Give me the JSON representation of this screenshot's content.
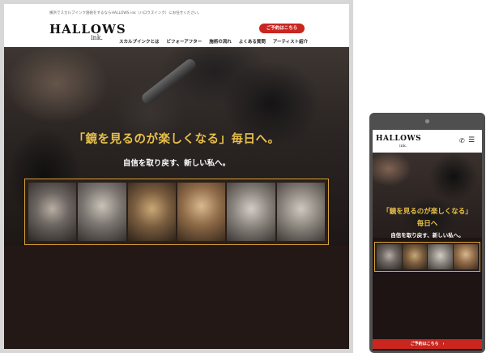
{
  "desktop": {
    "notice": "横浜でスカルプインク施術をするならHALLOWS ink（ハロウズインク）にお任せください。",
    "logo": "HALLOWS",
    "logo_sub": "ink.",
    "cta": "ご予約はこちら",
    "nav": [
      "スカルプインクとは",
      "ビフォーアフター",
      "施術の流れ",
      "よくある質問",
      "アーティスト紹介"
    ],
    "tagline": "「鏡を見るのが楽しくなる」毎日へ。",
    "subtitle": "自信を取り戻す、新しい私へ。"
  },
  "phone": {
    "logo": "HALLOWS",
    "logo_sub": "ink.",
    "tagline_line1": "「鏡を見るのが楽しくなる」",
    "tagline_line2": "毎日へ",
    "subtitle": "自信を取り戻す、新しい私へ。",
    "cta": "ご予約はこちら　›"
  },
  "colors": {
    "accent_red": "#c8261f",
    "tagline_gold": "#e7c04a",
    "strip_border": "#d6a13b",
    "dark_bg": "#241816"
  },
  "icons": [
    "phone-icon",
    "hamburger-menu-icon"
  ]
}
